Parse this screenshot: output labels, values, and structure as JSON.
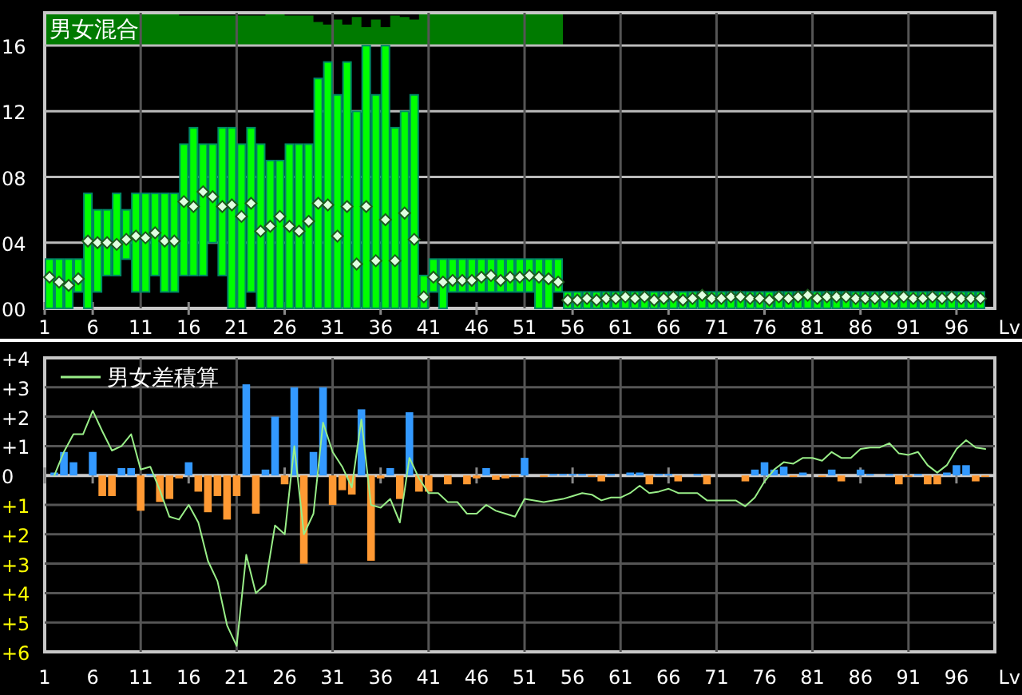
{
  "top_chart": {
    "chart_data": {
      "type": "candlestick",
      "title": "男女混合",
      "xlabel": "Lv",
      "xlim": [
        1,
        100
      ],
      "ylim": [
        0,
        18
      ],
      "grid": true,
      "x": [
        1.5,
        2.5,
        3.5,
        4.5,
        5.5,
        6.5,
        7.5,
        8.5,
        9.5,
        10.5,
        11.5,
        12.5,
        13.5,
        14.5,
        15.5,
        16.5,
        17.5,
        18.5,
        19.5,
        20.5,
        21.5,
        22.5,
        23.5,
        24.5,
        25.5,
        26.5,
        27.5,
        28.5,
        29.5,
        30.5,
        31.5,
        32.5,
        33.5,
        34.5,
        35.5,
        36.5,
        37.5,
        38.5,
        39.5,
        40.5,
        41.5,
        42.5,
        43.5,
        44.5,
        45.5,
        46.5,
        47.5,
        48.5,
        49.5,
        50.5,
        51.5,
        52.5,
        53.5,
        54.5,
        55.5,
        56.5,
        57.5,
        58.5,
        59.5,
        60.5,
        61.5,
        62.5,
        63.5,
        64.5,
        65.5,
        66.5,
        67.5,
        68.5,
        69.5,
        70.5,
        71.5,
        72.5,
        73.5,
        74.5,
        75.5,
        76.5,
        77.5,
        78.5,
        79.5,
        80.5,
        81.5,
        82.5,
        83.5,
        84.5,
        85.5,
        86.5,
        87.5,
        88.5,
        89.5,
        90.5,
        91.5,
        92.5,
        93.5,
        94.5,
        95.5,
        96.5,
        97.5,
        98.5
      ],
      "xticks": [
        1,
        6,
        11,
        16,
        21,
        26,
        31,
        36,
        41,
        46,
        51,
        56,
        61,
        66,
        71,
        76,
        81,
        86,
        91,
        96
      ],
      "yticks": [
        {
          "value": 0,
          "label": "00"
        },
        {
          "value": 4,
          "label": "04"
        },
        {
          "value": 8,
          "label": "08"
        },
        {
          "value": 12,
          "label": "12"
        },
        {
          "value": 16,
          "label": "16"
        }
      ],
      "series": [
        {
          "type": "candlestick",
          "color": "#00ff00",
          "ohlc": [
            [
              0,
              3,
              0,
              3
            ],
            [
              0,
              3,
              0,
              3
            ],
            [
              0,
              3,
              0,
              3
            ],
            [
              1,
              3,
              1,
              3
            ],
            [
              0,
              7,
              0,
              7
            ],
            [
              1,
              6,
              1,
              6
            ],
            [
              2,
              6,
              2,
              6
            ],
            [
              2,
              7,
              2,
              7
            ],
            [
              3,
              6,
              3,
              6
            ],
            [
              1,
              7,
              1,
              7
            ],
            [
              1,
              7,
              1,
              7
            ],
            [
              2,
              7,
              2,
              7
            ],
            [
              1,
              7,
              1,
              7
            ],
            [
              1,
              7,
              1,
              7
            ],
            [
              2,
              10,
              2,
              10
            ],
            [
              2,
              11,
              2,
              11
            ],
            [
              2,
              10,
              2,
              10
            ],
            [
              4,
              10,
              4,
              10
            ],
            [
              2,
              11,
              2,
              11
            ],
            [
              0,
              11,
              0,
              11
            ],
            [
              0,
              10,
              0,
              10
            ],
            [
              1,
              11,
              1,
              11
            ],
            [
              0,
              10,
              0,
              10
            ],
            [
              0,
              9,
              0,
              9
            ],
            [
              0,
              9,
              0,
              9
            ],
            [
              0,
              10,
              0,
              10
            ],
            [
              0,
              10,
              0,
              10
            ],
            [
              0,
              10,
              0,
              10
            ],
            [
              0,
              14,
              0,
              14
            ],
            [
              0,
              15,
              0,
              15
            ],
            [
              0,
              13,
              0,
              13
            ],
            [
              0,
              15,
              0,
              15
            ],
            [
              0,
              12,
              0,
              12
            ],
            [
              0,
              16,
              0,
              16
            ],
            [
              0,
              13,
              0,
              13
            ],
            [
              0,
              16,
              0,
              16
            ],
            [
              0,
              11,
              0,
              11
            ],
            [
              0,
              12,
              0,
              12
            ],
            [
              0,
              13,
              0,
              13
            ],
            [
              0,
              2,
              0,
              2
            ],
            [
              1,
              3,
              1,
              3
            ],
            [
              0,
              3,
              0,
              3
            ],
            [
              1,
              3,
              1,
              3
            ],
            [
              1,
              3,
              1,
              3
            ],
            [
              1,
              3,
              1,
              3
            ],
            [
              1,
              3,
              1,
              3
            ],
            [
              1,
              3,
              1,
              3
            ],
            [
              1,
              3,
              1,
              3
            ],
            [
              1,
              3,
              1,
              3
            ],
            [
              1,
              3,
              1,
              3
            ],
            [
              1,
              3,
              1,
              3
            ],
            [
              0,
              3,
              0,
              3
            ],
            [
              0,
              3,
              0,
              3
            ],
            [
              1,
              3,
              1,
              3
            ],
            [
              0,
              1,
              0,
              1
            ],
            [
              0,
              1,
              0,
              1
            ],
            [
              0,
              1,
              0,
              1
            ],
            [
              0,
              1,
              0,
              1
            ],
            [
              0,
              1,
              0,
              1
            ],
            [
              0,
              1,
              0,
              1
            ],
            [
              0,
              1,
              0,
              1
            ],
            [
              0,
              1,
              0,
              1
            ],
            [
              0,
              1,
              0,
              1
            ],
            [
              0,
              1,
              0,
              1
            ],
            [
              0,
              1,
              0,
              1
            ],
            [
              0,
              1,
              0,
              1
            ],
            [
              0,
              1,
              0,
              1
            ],
            [
              0,
              1,
              0,
              1
            ],
            [
              0,
              1,
              0,
              1
            ],
            [
              0,
              1,
              0,
              1
            ],
            [
              0,
              1,
              0,
              1
            ],
            [
              0,
              1,
              0,
              1
            ],
            [
              0,
              1,
              0,
              1
            ],
            [
              0,
              1,
              0,
              1
            ],
            [
              0,
              1,
              0,
              1
            ],
            [
              0,
              1,
              0,
              1
            ],
            [
              0,
              1,
              0,
              1
            ],
            [
              0,
              1,
              0,
              1
            ],
            [
              0,
              1,
              0,
              1
            ],
            [
              0,
              1,
              0,
              1
            ],
            [
              0,
              1,
              0,
              1
            ],
            [
              0,
              1,
              0,
              1
            ],
            [
              0,
              1,
              0,
              1
            ],
            [
              0,
              1,
              0,
              1
            ],
            [
              0,
              1,
              0,
              1
            ],
            [
              0,
              1,
              0,
              1
            ],
            [
              0,
              1,
              0,
              1
            ],
            [
              0,
              1,
              0,
              1
            ],
            [
              0,
              1,
              0,
              1
            ],
            [
              0,
              1,
              0,
              1
            ],
            [
              0,
              1,
              0,
              1
            ],
            [
              0,
              1,
              0,
              1
            ],
            [
              0,
              1,
              0,
              1
            ],
            [
              0,
              1,
              0,
              1
            ],
            [
              0,
              1,
              0,
              1
            ],
            [
              0,
              1,
              0,
              1
            ],
            [
              0,
              1,
              0,
              1
            ],
            [
              0,
              1,
              0,
              1
            ]
          ]
        },
        {
          "type": "scatter",
          "color": "#e0ffe0",
          "values": [
            1.9,
            1.6,
            1.4,
            1.8,
            4.1,
            4.0,
            4.0,
            3.9,
            4.2,
            4.4,
            4.3,
            4.6,
            4.1,
            4.1,
            6.5,
            6.2,
            7.1,
            6.8,
            6.2,
            6.3,
            5.6,
            6.4,
            4.7,
            5.0,
            5.6,
            5.0,
            4.7,
            5.3,
            6.4,
            6.3,
            4.4,
            6.2,
            2.7,
            6.2,
            2.9,
            5.4,
            2.9,
            5.8,
            4.2,
            0.7,
            1.9,
            1.6,
            1.7,
            1.7,
            1.7,
            1.9,
            2.0,
            1.7,
            1.9,
            1.9,
            2.0,
            1.9,
            1.8,
            1.6,
            0.5,
            0.5,
            0.6,
            0.5,
            0.6,
            0.6,
            0.7,
            0.6,
            0.7,
            0.5,
            0.6,
            0.7,
            0.5,
            0.6,
            0.8,
            0.6,
            0.6,
            0.7,
            0.7,
            0.6,
            0.6,
            0.5,
            0.7,
            0.6,
            0.7,
            0.8,
            0.6,
            0.7,
            0.7,
            0.7,
            0.6,
            0.6,
            0.6,
            0.7,
            0.6,
            0.7,
            0.6,
            0.6,
            0.7,
            0.6,
            0.7,
            0.6,
            0.6,
            0.6
          ]
        }
      ]
    }
  },
  "bottom_chart": {
    "chart_data": {
      "type": "bar",
      "xlabel": "Lv",
      "xlim": [
        1,
        100
      ],
      "ylim": [
        -6,
        4
      ],
      "grid": true,
      "x": [
        2,
        3,
        4,
        5,
        6,
        7,
        8,
        9,
        10,
        11,
        12,
        13,
        14,
        15,
        16,
        17,
        18,
        19,
        20,
        21,
        22,
        23,
        24,
        25,
        26,
        27,
        28,
        29,
        30,
        31,
        32,
        33,
        34,
        35,
        36,
        37,
        38,
        39,
        40,
        41,
        42,
        43,
        44,
        45,
        46,
        47,
        48,
        49,
        50,
        51,
        52,
        53,
        54,
        55,
        56,
        57,
        58,
        59,
        60,
        61,
        62,
        63,
        64,
        65,
        66,
        67,
        68,
        69,
        70,
        71,
        72,
        73,
        74,
        75,
        76,
        77,
        78,
        79,
        80,
        81,
        82,
        83,
        84,
        85,
        86,
        87,
        88,
        89,
        90,
        91,
        92,
        93,
        94,
        95,
        96,
        97,
        98,
        99
      ],
      "xticks": [
        1,
        6,
        11,
        16,
        21,
        26,
        31,
        36,
        41,
        46,
        51,
        56,
        61,
        66,
        71,
        76,
        81,
        86,
        91,
        96
      ],
      "yticks": [
        {
          "value": 4,
          "label": "+4"
        },
        {
          "value": 3,
          "label": "+3"
        },
        {
          "value": 2,
          "label": "+2"
        },
        {
          "value": 1,
          "label": "+1"
        },
        {
          "value": 0,
          "label": "0"
        },
        {
          "value": -1,
          "label": "+1"
        },
        {
          "value": -2,
          "label": "+2"
        },
        {
          "value": -3,
          "label": "+3"
        },
        {
          "value": -4,
          "label": "+4"
        },
        {
          "value": -5,
          "label": "+5"
        },
        {
          "value": -6,
          "label": "+6"
        }
      ],
      "series": [
        {
          "type": "bar",
          "color": "#3399ff",
          "values": [
            0.1,
            0.8,
            0.45,
            null,
            0.8,
            null,
            null,
            0.25,
            0.25,
            null,
            0.05,
            null,
            null,
            null,
            0.45,
            null,
            null,
            null,
            null,
            null,
            3.1,
            null,
            0.2,
            2.0,
            null,
            3.0,
            null,
            0.8,
            3.0,
            null,
            null,
            null,
            2.25,
            null,
            null,
            0.25,
            null,
            2.15,
            null,
            null,
            null,
            null,
            null,
            null,
            null,
            0.25,
            null,
            null,
            null,
            0.6,
            null,
            null,
            0.05,
            0.05,
            0.05,
            0.05,
            null,
            null,
            0.05,
            null,
            0.1,
            0.1,
            null,
            0.05,
            0.05,
            null,
            null,
            0.05,
            null,
            null,
            null,
            null,
            null,
            0.2,
            0.45,
            0.2,
            0.3,
            null,
            0.1,
            null,
            null,
            0.2,
            null,
            null,
            0.2,
            0.05,
            null,
            0.05,
            null,
            null,
            0.05,
            null,
            null,
            0.1,
            0.35,
            0.35,
            null,
            null
          ]
        },
        {
          "type": "bar",
          "color": "#ff9933",
          "values": [
            null,
            null,
            null,
            null,
            null,
            -0.7,
            -0.7,
            null,
            null,
            -1.2,
            null,
            -0.9,
            -0.8,
            -0.1,
            null,
            -0.55,
            -1.25,
            -0.7,
            -1.5,
            -0.7,
            null,
            -1.3,
            null,
            null,
            -0.3,
            null,
            -3.0,
            null,
            null,
            -1.0,
            -0.5,
            -0.65,
            null,
            -2.9,
            -0.1,
            null,
            -0.8,
            null,
            -0.55,
            -0.55,
            null,
            -0.3,
            null,
            -0.3,
            -0.1,
            null,
            -0.15,
            -0.1,
            -0.05,
            null,
            null,
            -0.05,
            null,
            null,
            null,
            null,
            -0.05,
            -0.2,
            null,
            null,
            null,
            null,
            -0.3,
            null,
            null,
            -0.2,
            null,
            null,
            -0.3,
            null,
            null,
            null,
            -0.2,
            null,
            null,
            null,
            null,
            -0.05,
            null,
            null,
            -0.05,
            null,
            -0.2,
            null,
            null,
            null,
            null,
            null,
            -0.3,
            -0.05,
            null,
            -0.3,
            -0.3,
            null,
            null,
            null,
            -0.2,
            -0.05
          ]
        },
        {
          "type": "line",
          "name": "男女差積算",
          "color": "#99ee88",
          "values": [
            0,
            0.8,
            1.4,
            1.4,
            2.2,
            1.5,
            0.85,
            1.0,
            1.4,
            0.2,
            0.3,
            -0.5,
            -1.4,
            -1.5,
            -1.0,
            -1.6,
            -2.9,
            -3.6,
            -5.1,
            -5.8,
            -2.7,
            -4.0,
            -3.7,
            -1.7,
            -2.0,
            1.0,
            -2.0,
            -1.3,
            1.8,
            0.8,
            0.3,
            -0.4,
            1.9,
            -1.0,
            -1.1,
            -0.8,
            -1.6,
            0.6,
            -0.1,
            -0.6,
            -0.6,
            -0.9,
            -0.9,
            -1.3,
            -1.3,
            -1.0,
            -1.2,
            -1.3,
            -1.4,
            -0.8,
            -0.85,
            -0.9,
            -0.85,
            -0.8,
            -0.7,
            -0.6,
            -0.65,
            -0.85,
            -0.75,
            -0.75,
            -0.6,
            -0.35,
            -0.6,
            -0.55,
            -0.45,
            -0.6,
            -0.6,
            -0.6,
            -0.85,
            -0.85,
            -0.85,
            -0.85,
            -1.05,
            -0.75,
            -0.2,
            0.2,
            0.45,
            0.4,
            0.6,
            0.6,
            0.5,
            0.8,
            0.6,
            0.6,
            0.9,
            0.95,
            0.95,
            1.1,
            0.75,
            0.7,
            0.8,
            0.35,
            0.1,
            0.35,
            0.9,
            1.2,
            0.95,
            0.9
          ]
        }
      ]
    }
  }
}
